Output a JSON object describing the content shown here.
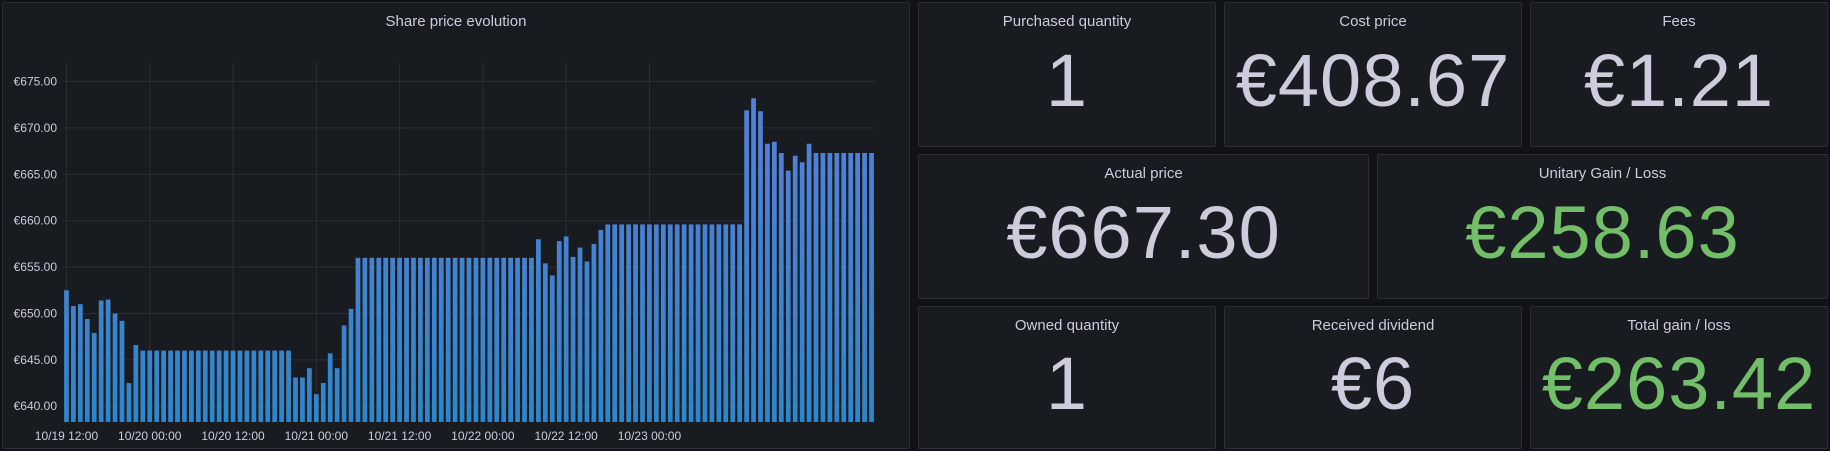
{
  "colors": {
    "neutral": "#ccccdc",
    "positive": "#73bf69",
    "bar_top": "#5b7fdc",
    "bar_bottom": "#2e86c9"
  },
  "chart_panel": {
    "title": "Share price evolution"
  },
  "stats": {
    "purchased_quantity": {
      "title": "Purchased quantity",
      "value": "1"
    },
    "cost_price": {
      "title": "Cost price",
      "value": "€408.67"
    },
    "fees": {
      "title": "Fees",
      "value": "€1.21"
    },
    "actual_price": {
      "title": "Actual price",
      "value": "€667.30"
    },
    "unitary_gain": {
      "title": "Unitary Gain / Loss",
      "value": "€258.63"
    },
    "owned_quantity": {
      "title": "Owned quantity",
      "value": "1"
    },
    "received_dividend": {
      "title": "Received dividend",
      "value": "€6"
    },
    "total_gain": {
      "title": "Total gain / loss",
      "value": "€263.42"
    }
  },
  "chart_data": {
    "type": "bar",
    "title": "Share price evolution",
    "y_ticks": [
      "€640.00",
      "€645.00",
      "€650.00",
      "€655.00",
      "€660.00",
      "€665.00",
      "€670.00",
      "€675.00"
    ],
    "x_ticks": [
      "10/19 12:00",
      "10/20 00:00",
      "10/20 12:00",
      "10/21 00:00",
      "10/21 12:00",
      "10/22 00:00",
      "10/22 12:00",
      "10/23 00:00"
    ],
    "x_tick_positions": [
      0,
      12,
      24,
      36,
      48,
      60,
      72,
      84
    ],
    "ylim": [
      638.3,
      677
    ],
    "grid": true,
    "values": [
      652.5,
      650.8,
      651.0,
      649.4,
      647.9,
      651.4,
      651.5,
      650.0,
      649.2,
      642.5,
      646.6,
      646.0,
      646.0,
      646.0,
      646.0,
      646.0,
      646.0,
      646.0,
      646.0,
      646.0,
      646.0,
      646.0,
      646.0,
      646.0,
      646.0,
      646.0,
      646.0,
      646.0,
      646.0,
      646.0,
      646.0,
      646.0,
      646.0,
      643.1,
      643.1,
      644.1,
      641.3,
      642.5,
      645.7,
      644.1,
      648.7,
      650.5,
      656.0,
      656.0,
      656.0,
      656.0,
      656.0,
      656.0,
      656.0,
      656.0,
      656.0,
      656.0,
      656.0,
      656.0,
      656.0,
      656.0,
      656.0,
      656.0,
      656.0,
      656.0,
      656.0,
      656.0,
      656.0,
      656.0,
      656.0,
      656.0,
      656.0,
      656.0,
      658.0,
      655.4,
      654.1,
      657.8,
      658.3,
      656.1,
      657.1,
      655.6,
      657.5,
      659.0,
      659.6,
      659.6,
      659.6,
      659.6,
      659.6,
      659.6,
      659.6,
      659.6,
      659.6,
      659.6,
      659.6,
      659.6,
      659.6,
      659.6,
      659.6,
      659.6,
      659.6,
      659.6,
      659.6,
      659.6,
      671.9,
      673.2,
      671.8,
      668.3,
      668.5,
      667.3,
      665.4,
      667.0,
      666.3,
      668.3,
      667.3,
      667.3,
      667.3,
      667.3,
      667.3,
      667.3,
      667.3,
      667.3,
      667.3
    ]
  }
}
